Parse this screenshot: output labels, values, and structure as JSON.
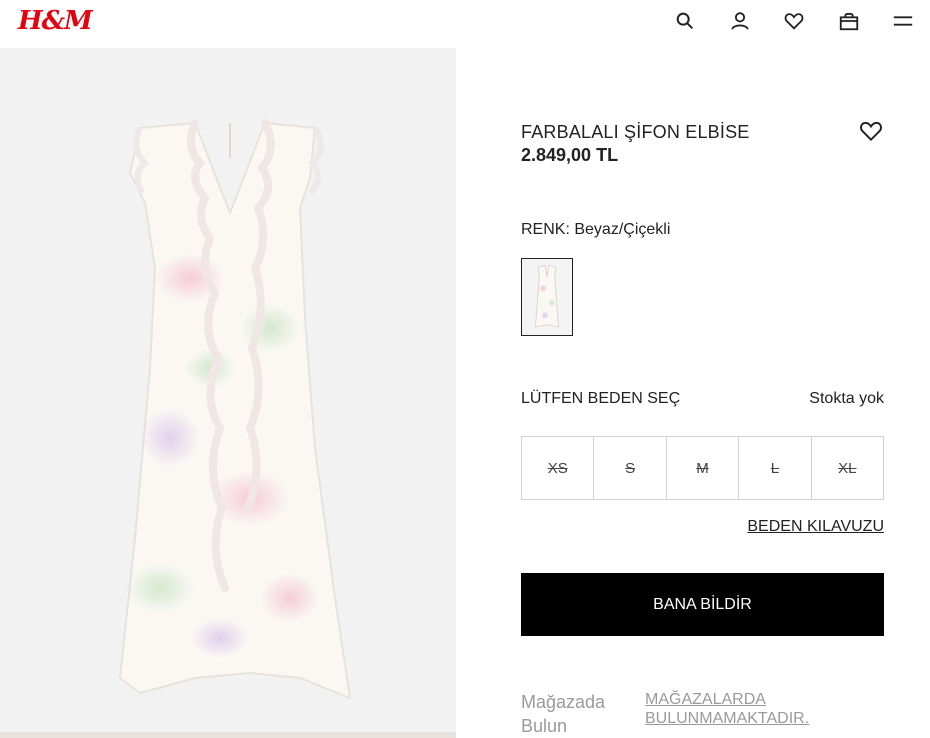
{
  "header": {
    "logo": "H&M",
    "icons": [
      "search-icon",
      "account-icon",
      "favorites-icon",
      "bag-icon",
      "menu-icon"
    ]
  },
  "product": {
    "title": "FARBALALI ŞİFON ELBİSE",
    "price": "2.849,00 TL",
    "color_label": "RENK: Beyaz/Çiçekli",
    "size_prompt": "LÜTFEN BEDEN SEÇ",
    "stock_status": "Stokta yok",
    "sizes": [
      "XS",
      "S",
      "M",
      "L",
      "XL"
    ],
    "size_guide": "BEDEN KILAVUZU",
    "notify_button": "BANA BİLDİR",
    "store_find": "Mağazada Bulun",
    "store_status": "MAĞAZALARDA BULUNMAMAKTADIR."
  },
  "colors": {
    "brand": "#e50010",
    "button_bg": "#000000",
    "muted_text": "#9a9a9a"
  }
}
